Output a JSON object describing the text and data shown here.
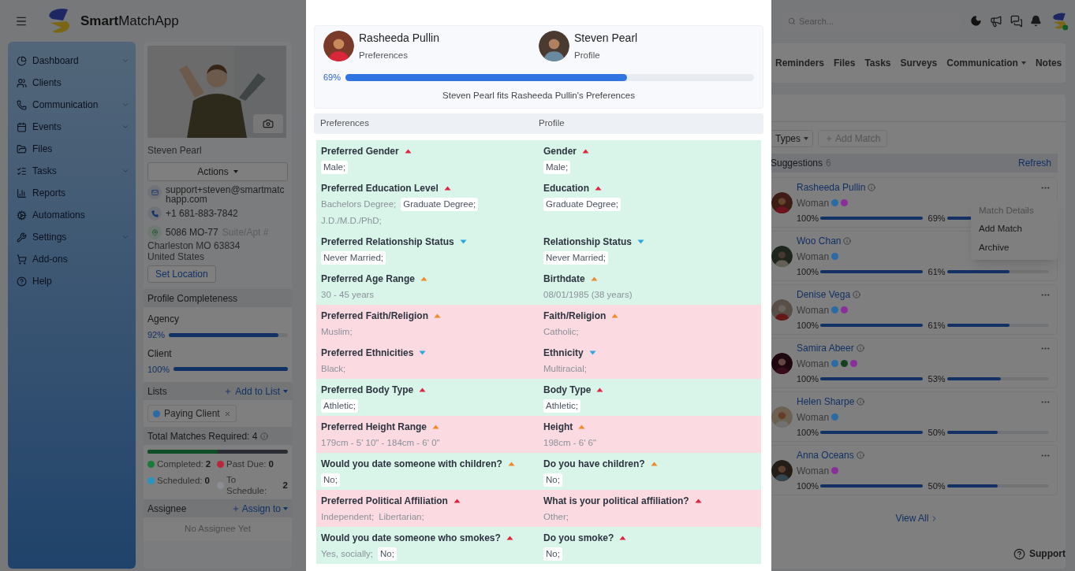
{
  "app": {
    "name": "**Smart**MatchApp"
  },
  "sidebar": {
    "items": [
      {
        "label": "Dashboard",
        "has_submenu": true
      },
      {
        "label": "Clients",
        "has_submenu": false
      },
      {
        "label": "Communication",
        "has_submenu": true
      },
      {
        "label": "Events",
        "has_submenu": true
      },
      {
        "label": "Files",
        "has_submenu": false
      },
      {
        "label": "Tasks",
        "has_submenu": true
      },
      {
        "label": "Reports",
        "has_submenu": false
      },
      {
        "label": "Automations",
        "has_submenu": false
      },
      {
        "label": "Settings",
        "has_submenu": true
      },
      {
        "label": "Add-ons",
        "has_submenu": false
      },
      {
        "label": "Help",
        "has_submenu": false
      }
    ]
  },
  "profile": {
    "name": "Steven Pearl",
    "actions": "Actions",
    "email": "support+steven@smartmatchapp.com",
    "phone": "+1 681-883-7842",
    "street": "5086 MO-77",
    "suite_field": {
      "placeholder": "Suite/Apt #"
    },
    "city": "Charleston MO 63834",
    "country": "United States",
    "set_location": "Set Location",
    "completeness": {
      "title": "Profile Completeness",
      "bars": [
        {
          "label": "Agency",
          "reading": "92%",
          "level": 0.92
        },
        {
          "label": "Client",
          "reading": "100%",
          "level": 1
        }
      ]
    },
    "lists": {
      "title": "Lists",
      "add": "Add to List",
      "tags": [
        {
          "label": "Paying Client",
          "color": "#2a6aa5"
        }
      ]
    },
    "matches": {
      "title": "Total Matches Required: 4",
      "level": 0.5,
      "legend": [
        {
          "label": "Completed:",
          "value": "2",
          "color": "#1a7a3a"
        },
        {
          "label": "Past Due:",
          "value": "0",
          "color": "#b8283a"
        },
        {
          "label": "Scheduled:",
          "value": "0",
          "color": "#2a94c0"
        },
        {
          "label": "To Schedule:",
          "value": "2",
          "color": "#8a8d92"
        }
      ]
    },
    "assignee": {
      "title": "Assignee",
      "add": "Assign to",
      "empty": "No Assignee Yet"
    }
  },
  "topbar": {
    "search_placeholder": "Search..."
  },
  "tabs": [
    {
      "label": "Reminders",
      "dropdown": false,
      "selected": false
    },
    {
      "label": "Files",
      "dropdown": false,
      "selected": false
    },
    {
      "label": "Tasks",
      "dropdown": false,
      "selected": false
    },
    {
      "label": "Surveys",
      "dropdown": false,
      "selected": false
    },
    {
      "label": "Communication",
      "dropdown": true,
      "selected": false
    },
    {
      "label": "Notes",
      "dropdown": false,
      "selected": false
    }
  ],
  "suggestions": {
    "types_button": "Types",
    "add_match": "Add Match",
    "title": "Suggestions",
    "count": "6",
    "refresh": "Refresh",
    "view_all": "View All",
    "items": [
      {
        "name": "Rasheeda Pullin",
        "menu_open": true,
        "gender": "Woman",
        "dots": [
          {
            "color": "#2a6aa5"
          },
          {
            "color": "#8a2f9a"
          }
        ],
        "bars": [
          {
            "reading": "100%",
            "level": 1
          },
          {
            "reading": "69%",
            "level": 0.69
          }
        ]
      },
      {
        "name": "Woo Chan",
        "menu_open": false,
        "gender": "Woman",
        "dots": [
          {
            "color": "#2a6aa5"
          }
        ],
        "bars": [
          {
            "reading": "100%",
            "level": 1
          },
          {
            "reading": "61%",
            "level": 0.61
          }
        ]
      },
      {
        "name": "Denise Vega",
        "menu_open": false,
        "gender": "Woman",
        "dots": [
          {
            "color": "#2a6aa5"
          },
          {
            "color": "#8a2f9a"
          }
        ],
        "bars": [
          {
            "reading": "100%",
            "level": 1
          },
          {
            "reading": "61%",
            "level": 0.61
          }
        ]
      },
      {
        "name": "Samira Abeer",
        "menu_open": false,
        "gender": "Woman",
        "dots": [
          {
            "color": "#2a6aa5"
          },
          {
            "color": "#17401f"
          },
          {
            "color": "#8a2f9a"
          }
        ],
        "bars": [
          {
            "reading": "100%",
            "level": 1
          },
          {
            "reading": "53%",
            "level": 0.53
          }
        ]
      },
      {
        "name": "Helen Sharpe",
        "menu_open": false,
        "gender": "Woman",
        "dots": [
          {
            "color": "#2a6aa5"
          }
        ],
        "bars": [
          {
            "reading": "100%",
            "level": 1
          },
          {
            "reading": "50%",
            "level": 0.5
          }
        ]
      },
      {
        "name": "Anna Oceans",
        "menu_open": false,
        "gender": "Woman",
        "dots": [
          {
            "color": "#8a2f9a"
          }
        ],
        "bars": [
          {
            "reading": "100%",
            "level": 1
          },
          {
            "reading": "50%",
            "level": 0.5
          }
        ]
      }
    ],
    "menu": {
      "items": [
        {
          "label": "Match Details",
          "disabled": true
        },
        {
          "label": "Add Match",
          "disabled": false
        },
        {
          "label": "Archive",
          "disabled": false
        }
      ]
    }
  },
  "support": "Support",
  "match_modal": {
    "people": [
      {
        "name": "Rasheeda Pullin",
        "role": "Preferences"
      },
      {
        "name": "Steven Pearl",
        "role": "Profile"
      }
    ],
    "score": {
      "reading": "69%",
      "level": 0.69
    },
    "summary": "Steven Pearl fits Rasheeda Pullin's Preferences",
    "columns": [
      "Preferences",
      "Profile"
    ],
    "criteria": [
      {
        "matched": true,
        "kind": "high",
        "preference": {
          "label": "Preferred Gender",
          "values": [
            {
              "text": "Male;",
              "matched": true
            }
          ]
        },
        "profile": {
          "label": "Gender",
          "values": [
            {
              "text": "Male;",
              "matched": true
            }
          ]
        }
      },
      {
        "matched": true,
        "kind": "high",
        "preference": {
          "label": "Preferred Education Level",
          "values": [
            {
              "text": "Bachelors Degree;",
              "matched": false
            },
            {
              "text": "Graduate Degree;",
              "matched": true
            },
            {
              "text": "J.D./M.D./PhD;",
              "matched": false
            }
          ]
        },
        "profile": {
          "label": "Education",
          "values": [
            {
              "text": "Graduate Degree;",
              "matched": true
            }
          ]
        }
      },
      {
        "matched": true,
        "kind": "low",
        "preference": {
          "label": "Preferred Relationship Status",
          "values": [
            {
              "text": "Never Married;",
              "matched": true
            }
          ]
        },
        "profile": {
          "label": "Relationship Status",
          "values": [
            {
              "text": "Never Married;",
              "matched": true
            }
          ]
        }
      },
      {
        "matched": true,
        "kind": "medium",
        "preference": {
          "label": "Preferred Age Range",
          "values": [
            {
              "text": "30 - 45 years",
              "matched": false
            }
          ]
        },
        "profile": {
          "label": "Birthdate",
          "values": [
            {
              "text": "08/01/1985 (38 years)",
              "matched": false
            }
          ]
        }
      },
      {
        "matched": false,
        "kind": "medium",
        "preference": {
          "label": "Preferred Faith/Religion",
          "values": [
            {
              "text": "Muslim;",
              "matched": false
            }
          ]
        },
        "profile": {
          "label": "Faith/Religion",
          "values": [
            {
              "text": "Catholic;",
              "matched": false
            }
          ]
        }
      },
      {
        "matched": false,
        "kind": "low",
        "preference": {
          "label": "Preferred Ethnicities",
          "values": [
            {
              "text": "Black;",
              "matched": false
            }
          ]
        },
        "profile": {
          "label": "Ethnicity",
          "values": [
            {
              "text": "Multiracial;",
              "matched": false
            }
          ]
        }
      },
      {
        "matched": true,
        "kind": "high",
        "preference": {
          "label": "Preferred Body Type",
          "values": [
            {
              "text": "Athletic;",
              "matched": true
            }
          ]
        },
        "profile": {
          "label": "Body Type",
          "values": [
            {
              "text": "Athletic;",
              "matched": true
            }
          ]
        }
      },
      {
        "matched": false,
        "kind": "medium",
        "preference": {
          "label": "Preferred Height Range",
          "values": [
            {
              "text": "179cm - 5' 10\" - 184cm - 6' 0\"",
              "matched": false
            }
          ]
        },
        "profile": {
          "label": "Height",
          "values": [
            {
              "text": "198cm - 6' 6\"",
              "matched": false
            }
          ]
        }
      },
      {
        "matched": true,
        "kind": "medium",
        "preference": {
          "label": "Would you date someone with children?",
          "values": [
            {
              "text": "No;",
              "matched": true
            }
          ]
        },
        "profile": {
          "label": "Do you have children?",
          "values": [
            {
              "text": "No;",
              "matched": true
            }
          ]
        }
      },
      {
        "matched": false,
        "kind": "high",
        "preference": {
          "label": "Preferred Political Affiliation",
          "values": [
            {
              "text": "Independent;",
              "matched": false
            },
            {
              "text": "Libertarian;",
              "matched": false
            }
          ]
        },
        "profile": {
          "label": "What is your political affiliation?",
          "values": [
            {
              "text": "Other;",
              "matched": false
            }
          ]
        }
      },
      {
        "matched": true,
        "kind": "high",
        "preference": {
          "label": "Would you date someone who smokes?",
          "values": [
            {
              "text": "Yes, socially;",
              "matched": false
            },
            {
              "text": "No;",
              "matched": true
            }
          ]
        },
        "profile": {
          "label": "Do you smoke?",
          "values": [
            {
              "text": "No;",
              "matched": true
            }
          ]
        }
      }
    ]
  }
}
